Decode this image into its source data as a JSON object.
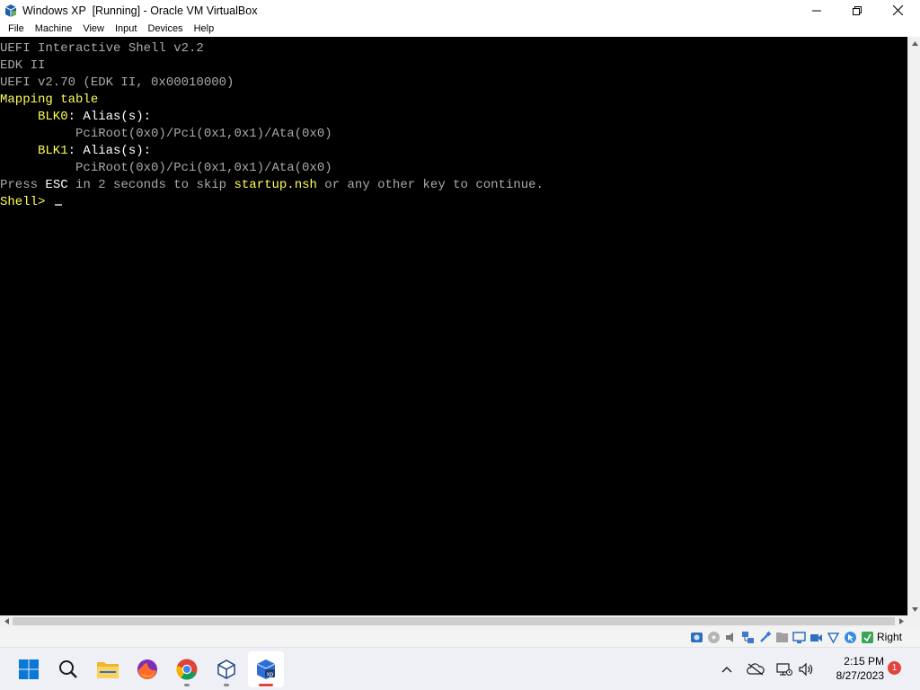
{
  "window": {
    "title": "Windows XP  [Running] - Oracle VM VirtualBox"
  },
  "menu": {
    "items": [
      "File",
      "Machine",
      "View",
      "Input",
      "Devices",
      "Help"
    ]
  },
  "terminal": {
    "lines": [
      [
        {
          "text": "UEFI Interactive Shell v2.2",
          "color": "gray"
        }
      ],
      [
        {
          "text": "EDK II",
          "color": "gray"
        }
      ],
      [
        {
          "text": "UEFI v2.70 (EDK II, 0x00010000)",
          "color": "gray"
        }
      ],
      [
        {
          "text": "Mapping table",
          "color": "yellow"
        }
      ],
      [
        {
          "text": "     BLK0",
          "color": "yellow"
        },
        {
          "text": ": Alias(s):",
          "color": "white"
        }
      ],
      [
        {
          "text": "          PciRoot(0x0)/Pci(0x1,0x1)/Ata(0x0)",
          "color": "gray"
        }
      ],
      [
        {
          "text": "     BLK1",
          "color": "yellow"
        },
        {
          "text": ": Alias(s):",
          "color": "white"
        }
      ],
      [
        {
          "text": "          PciRoot(0x0)/Pci(0x1,0x1)/Ata(0x0)",
          "color": "gray"
        }
      ],
      [
        {
          "text": "Press ",
          "color": "gray"
        },
        {
          "text": "ESC",
          "color": "white"
        },
        {
          "text": " in 2 seconds to skip ",
          "color": "gray"
        },
        {
          "text": "startup.nsh",
          "color": "yellow"
        },
        {
          "text": " or any other key to continue.",
          "color": "gray"
        }
      ],
      [
        {
          "text": "Shell> ",
          "color": "yellow"
        }
      ]
    ],
    "colors": {
      "gray": "#aaaaaa",
      "yellow": "#ffff55",
      "white": "#ffffff",
      "background": "#000000"
    }
  },
  "statusbar": {
    "icons": [
      "hard-disk-icon",
      "optical-drive-icon",
      "audio-icon",
      "network-icon",
      "usb-icon",
      "shared-folders-icon",
      "display-icon",
      "video-capture-icon",
      "cpu-icon",
      "mouse-integration-icon",
      "keyboard-icon"
    ],
    "host_key": "Right Ctrl"
  },
  "taskbar": {
    "apps": [
      "start-button",
      "search-button",
      "file-explorer-app",
      "firefox-app",
      "chrome-app",
      "virtualbox-manager-app",
      "virtualbox-xp-app"
    ],
    "time": "2:15 PM",
    "date": "8/27/2023",
    "notification_count": "1"
  }
}
